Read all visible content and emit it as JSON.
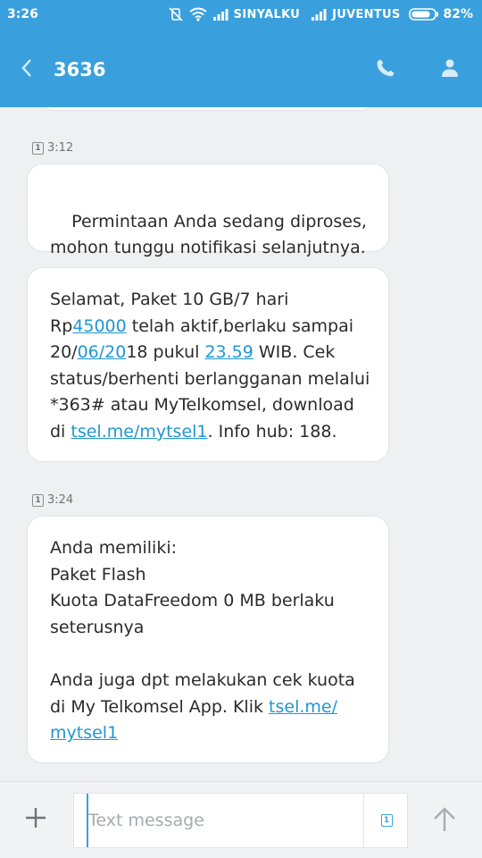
{
  "status_bar": {
    "time": "3:26",
    "operator1": "SINYALKU",
    "operator2": "JUVENTUS",
    "battery": "82%",
    "icons": [
      "vibrate-off-icon",
      "wifi-icon",
      "signal-icon",
      "battery-icon"
    ]
  },
  "header": {
    "title": "3636",
    "back_icon": "chevron-left-icon",
    "call_icon": "phone-icon",
    "contact_icon": "person-icon"
  },
  "sim_slot": "1",
  "thread": [
    {
      "time": "3:12",
      "messages": [
        {
          "segments": [
            {
              "text": "Permintaan Anda sedang diproses,\nmohon tunggu notifikasi selanjutnya."
            }
          ]
        },
        {
          "segments": [
            {
              "text": "Selamat, Paket 10 GB/7 hari\nRp"
            },
            {
              "text": "45000",
              "link": true
            },
            {
              "text": " telah aktif,berlaku sampai\n20/"
            },
            {
              "text": "06/20",
              "link": true
            },
            {
              "text": "18 pukul "
            },
            {
              "text": "23.59",
              "link": true
            },
            {
              "text": " WIB. Cek\nstatus/berhenti berlangganan melalui\n*363# atau MyTelkomsel, download\ndi "
            },
            {
              "text": "tsel.me/mytsel1",
              "link": true
            },
            {
              "text": ". Info hub: 188."
            }
          ]
        }
      ]
    },
    {
      "time": "3:24",
      "messages": [
        {
          "segments": [
            {
              "text": "Anda memiliki:\nPaket Flash\nKuota DataFreedom 0 MB berlaku\nseterusnya\n\nAnda juga dpt melakukan cek kuota\ndi My Telkomsel App. Klik "
            },
            {
              "text": "tsel.me/\nmytsel1",
              "link": true
            }
          ]
        }
      ]
    }
  ],
  "composer": {
    "placeholder": "Text message",
    "value": "",
    "add_icon": "plus-icon",
    "sim_icon": "sim-1-icon",
    "send_icon": "arrow-up-icon"
  },
  "colors": {
    "header": "#3aa0dd",
    "link": "#2196d3",
    "background": "#eef0f2"
  }
}
